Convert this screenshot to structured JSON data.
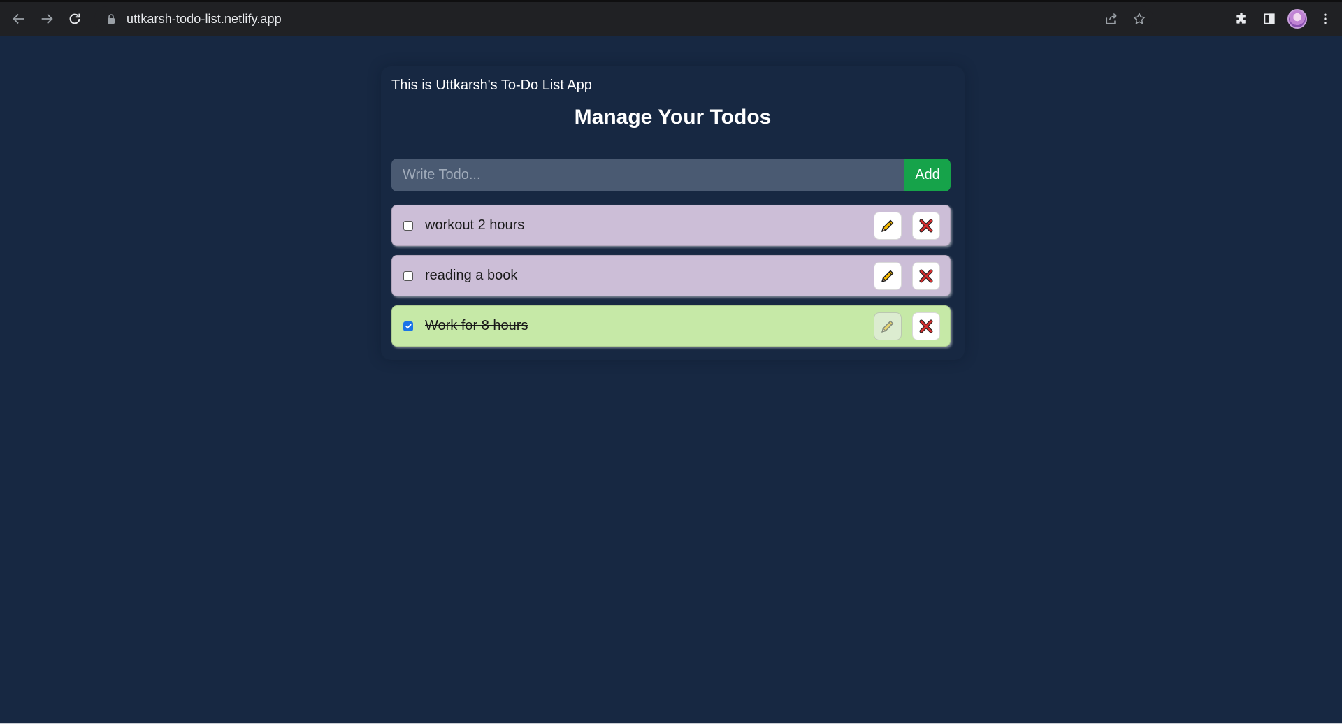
{
  "browser": {
    "url": "uttkarsh-todo-list.netlify.app"
  },
  "app": {
    "subtitle": "This is Uttkarsh's To-Do List App",
    "title": "Manage Your Todos",
    "input": {
      "placeholder": "Write Todo...",
      "value": ""
    },
    "add_label": "Add",
    "todos": [
      {
        "text": "workout 2 hours",
        "completed": false
      },
      {
        "text": "reading a book",
        "completed": false
      },
      {
        "text": "Work for 8 hours",
        "completed": true
      }
    ]
  },
  "colors": {
    "background": "#172842",
    "pending_item": "#ccbed7",
    "completed_item": "#c6e9a7",
    "add_button": "#16a34a",
    "delete_icon": "#d32f2f"
  }
}
